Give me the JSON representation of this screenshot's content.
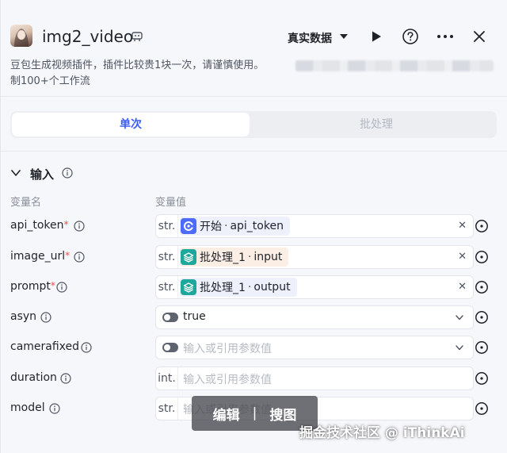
{
  "header": {
    "title": "img2_video",
    "run_mode": "真实数据",
    "description_line1": "豆包生成视频插件，插件比较贵1块一次，请谨慎使用。",
    "description_line2": "制100+个工作流"
  },
  "tabs": [
    {
      "label": "单次",
      "active": true
    },
    {
      "label": "批处理",
      "active": false
    }
  ],
  "input_section": {
    "title": "输入",
    "col_name": "变量名",
    "col_value": "变量值",
    "rows": [
      {
        "name": "api_token",
        "required": true,
        "type": "str.",
        "kind": "ref",
        "source": "开始",
        "sep": "·",
        "var": "api_token",
        "chip_color": "#eef0fb",
        "icon_color": "#4d6bfe",
        "icon": "start-icon"
      },
      {
        "name": "image_url",
        "required": true,
        "type": "str.",
        "kind": "ref",
        "source": "批处理_1",
        "sep": "·",
        "var": "input",
        "chip_color": "#fbeee4",
        "icon_color": "#1ea89b",
        "icon": "layers-icon"
      },
      {
        "name": "prompt",
        "required": true,
        "type": "str.",
        "kind": "ref",
        "source": "批处理_1",
        "sep": "·",
        "var": "output",
        "chip_color": "#eef0fb",
        "icon_color": "#1ea89b",
        "icon": "layers-icon"
      },
      {
        "name": "asyn",
        "required": false,
        "kind": "bool",
        "value": "true"
      },
      {
        "name": "camerafixed",
        "required": false,
        "kind": "bool",
        "placeholder": "输入或引用参数值"
      },
      {
        "name": "duration",
        "required": false,
        "type": "int.",
        "kind": "text",
        "placeholder": "输入或引用参数值"
      },
      {
        "name": "model",
        "required": false,
        "type": "str.",
        "kind": "text",
        "placeholder": "输入或引用参数值"
      }
    ]
  },
  "overlay": {
    "edit_label": "编辑",
    "separator": "|",
    "search_label": "搜图",
    "watermark": "掘金技术社区 @ iThinkAi"
  },
  "colors": {
    "accent": "#3b5bf6",
    "required": "#f54a45"
  }
}
